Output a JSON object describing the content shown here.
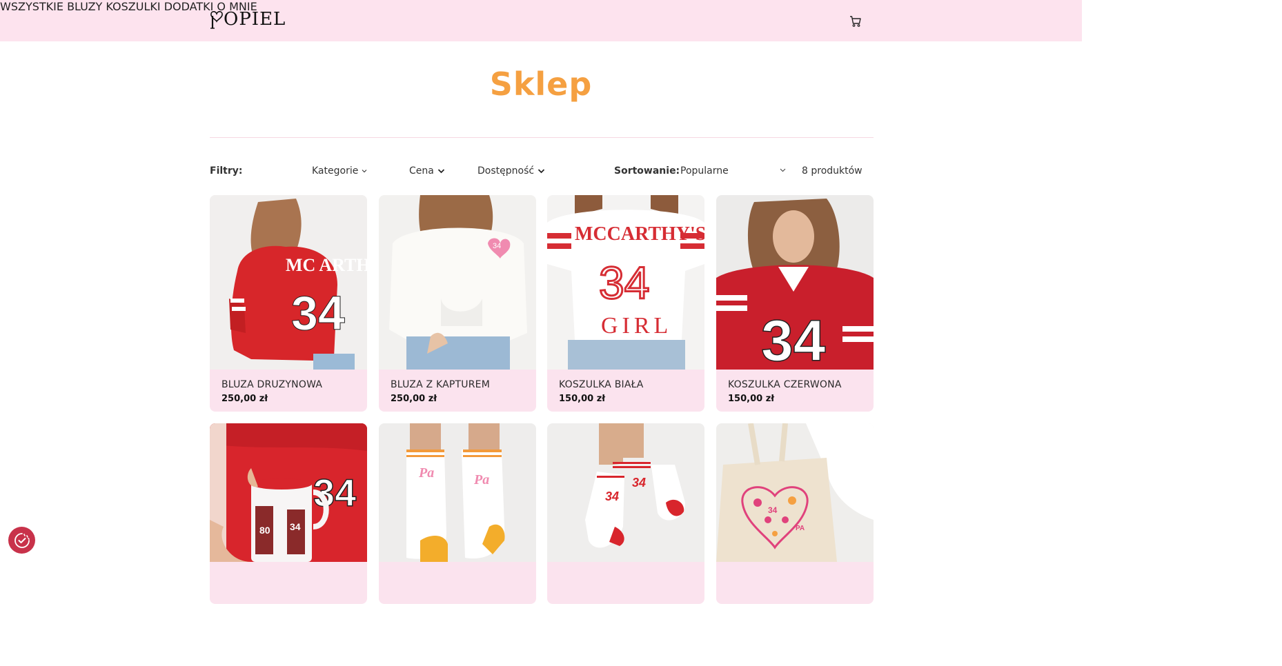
{
  "header": {
    "logo_text": "OPIEL",
    "nav": [
      {
        "label": "WSZYSTKIE"
      },
      {
        "label": "BLUZY"
      },
      {
        "label": "KOSZULKI"
      },
      {
        "label": "DODATKI"
      },
      {
        "label": "O MNIE"
      }
    ],
    "cart_icon": "cart-icon"
  },
  "page": {
    "title": "Sklep"
  },
  "toolbar": {
    "filters_label": "Filtry:",
    "filters": [
      "Kategorie",
      "Cena",
      "Dostępność"
    ],
    "sort_label": "Sortowanie:",
    "sort_value": "Popularne",
    "count_text": "8 produktów"
  },
  "products": [
    {
      "name": "BLUZA DRUZYNOWA",
      "price": "250,00 zł"
    },
    {
      "name": "BLUZA Z KAPTUREM",
      "price": "250,00 zł"
    },
    {
      "name": "KOSZULKA BIAŁA",
      "price": "150,00 zł"
    },
    {
      "name": "KOSZULKA CZERWONA",
      "price": "150,00 zł"
    },
    {
      "name": "",
      "price": ""
    },
    {
      "name": "",
      "price": ""
    },
    {
      "name": "",
      "price": ""
    },
    {
      "name": "",
      "price": ""
    }
  ],
  "colors": {
    "header_bg": "#fde3ee",
    "title": "#f5a041",
    "card_info_bg": "#fbe3ee",
    "cookie_button": "#c8324a"
  }
}
